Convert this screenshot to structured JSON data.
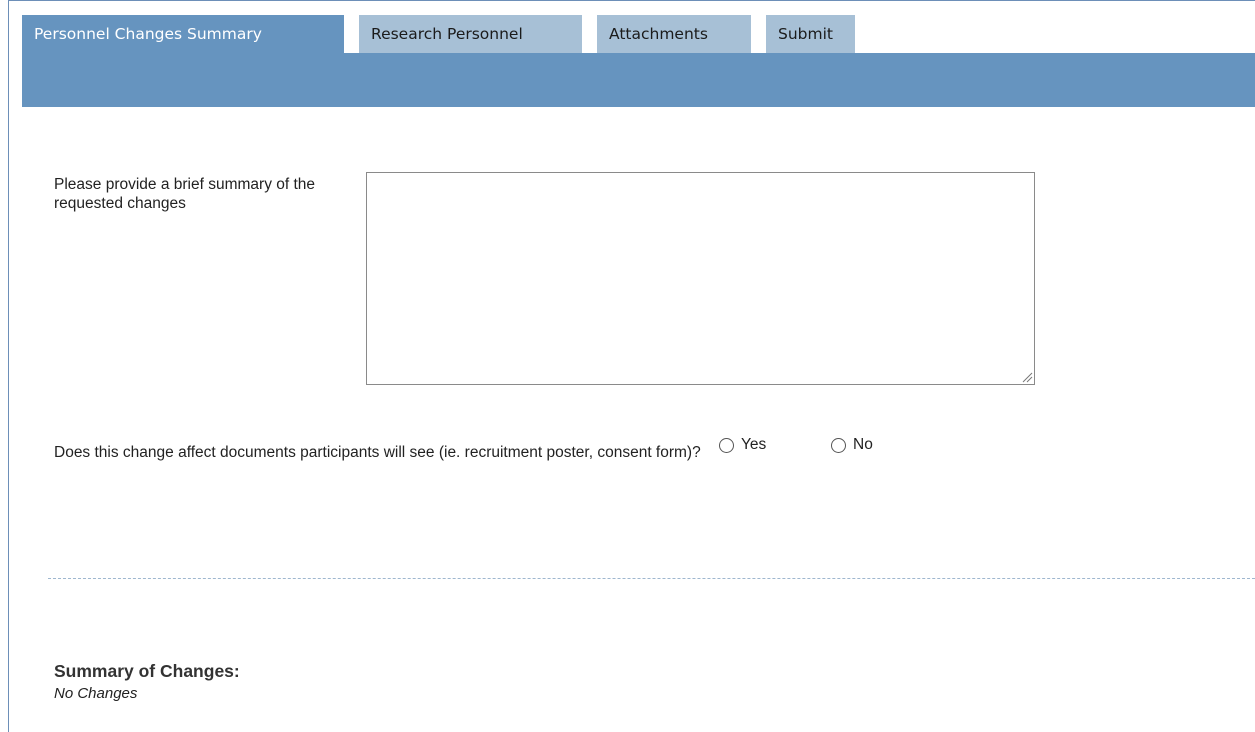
{
  "tabs": [
    {
      "label": "Personnel Changes Summary",
      "active": true
    },
    {
      "label": "Research Personnel",
      "active": false
    },
    {
      "label": "Attachments",
      "active": false
    },
    {
      "label": "Submit",
      "active": false
    }
  ],
  "summary_field": {
    "label": "Please provide a brief summary of the requested changes",
    "value": "",
    "placeholder": ""
  },
  "documents_question": {
    "label": "Does this change affect documents participants will see (ie. recruitment poster, consent form)?",
    "options": [
      "Yes",
      "No"
    ],
    "selected": null
  },
  "summary_section": {
    "title": "Summary of Changes:",
    "content": "No Changes"
  },
  "colors": {
    "tab_active": "#6694bf",
    "tab_inactive": "#a7c0d6",
    "band": "#6694bf",
    "divider": "#9fb7cf"
  }
}
